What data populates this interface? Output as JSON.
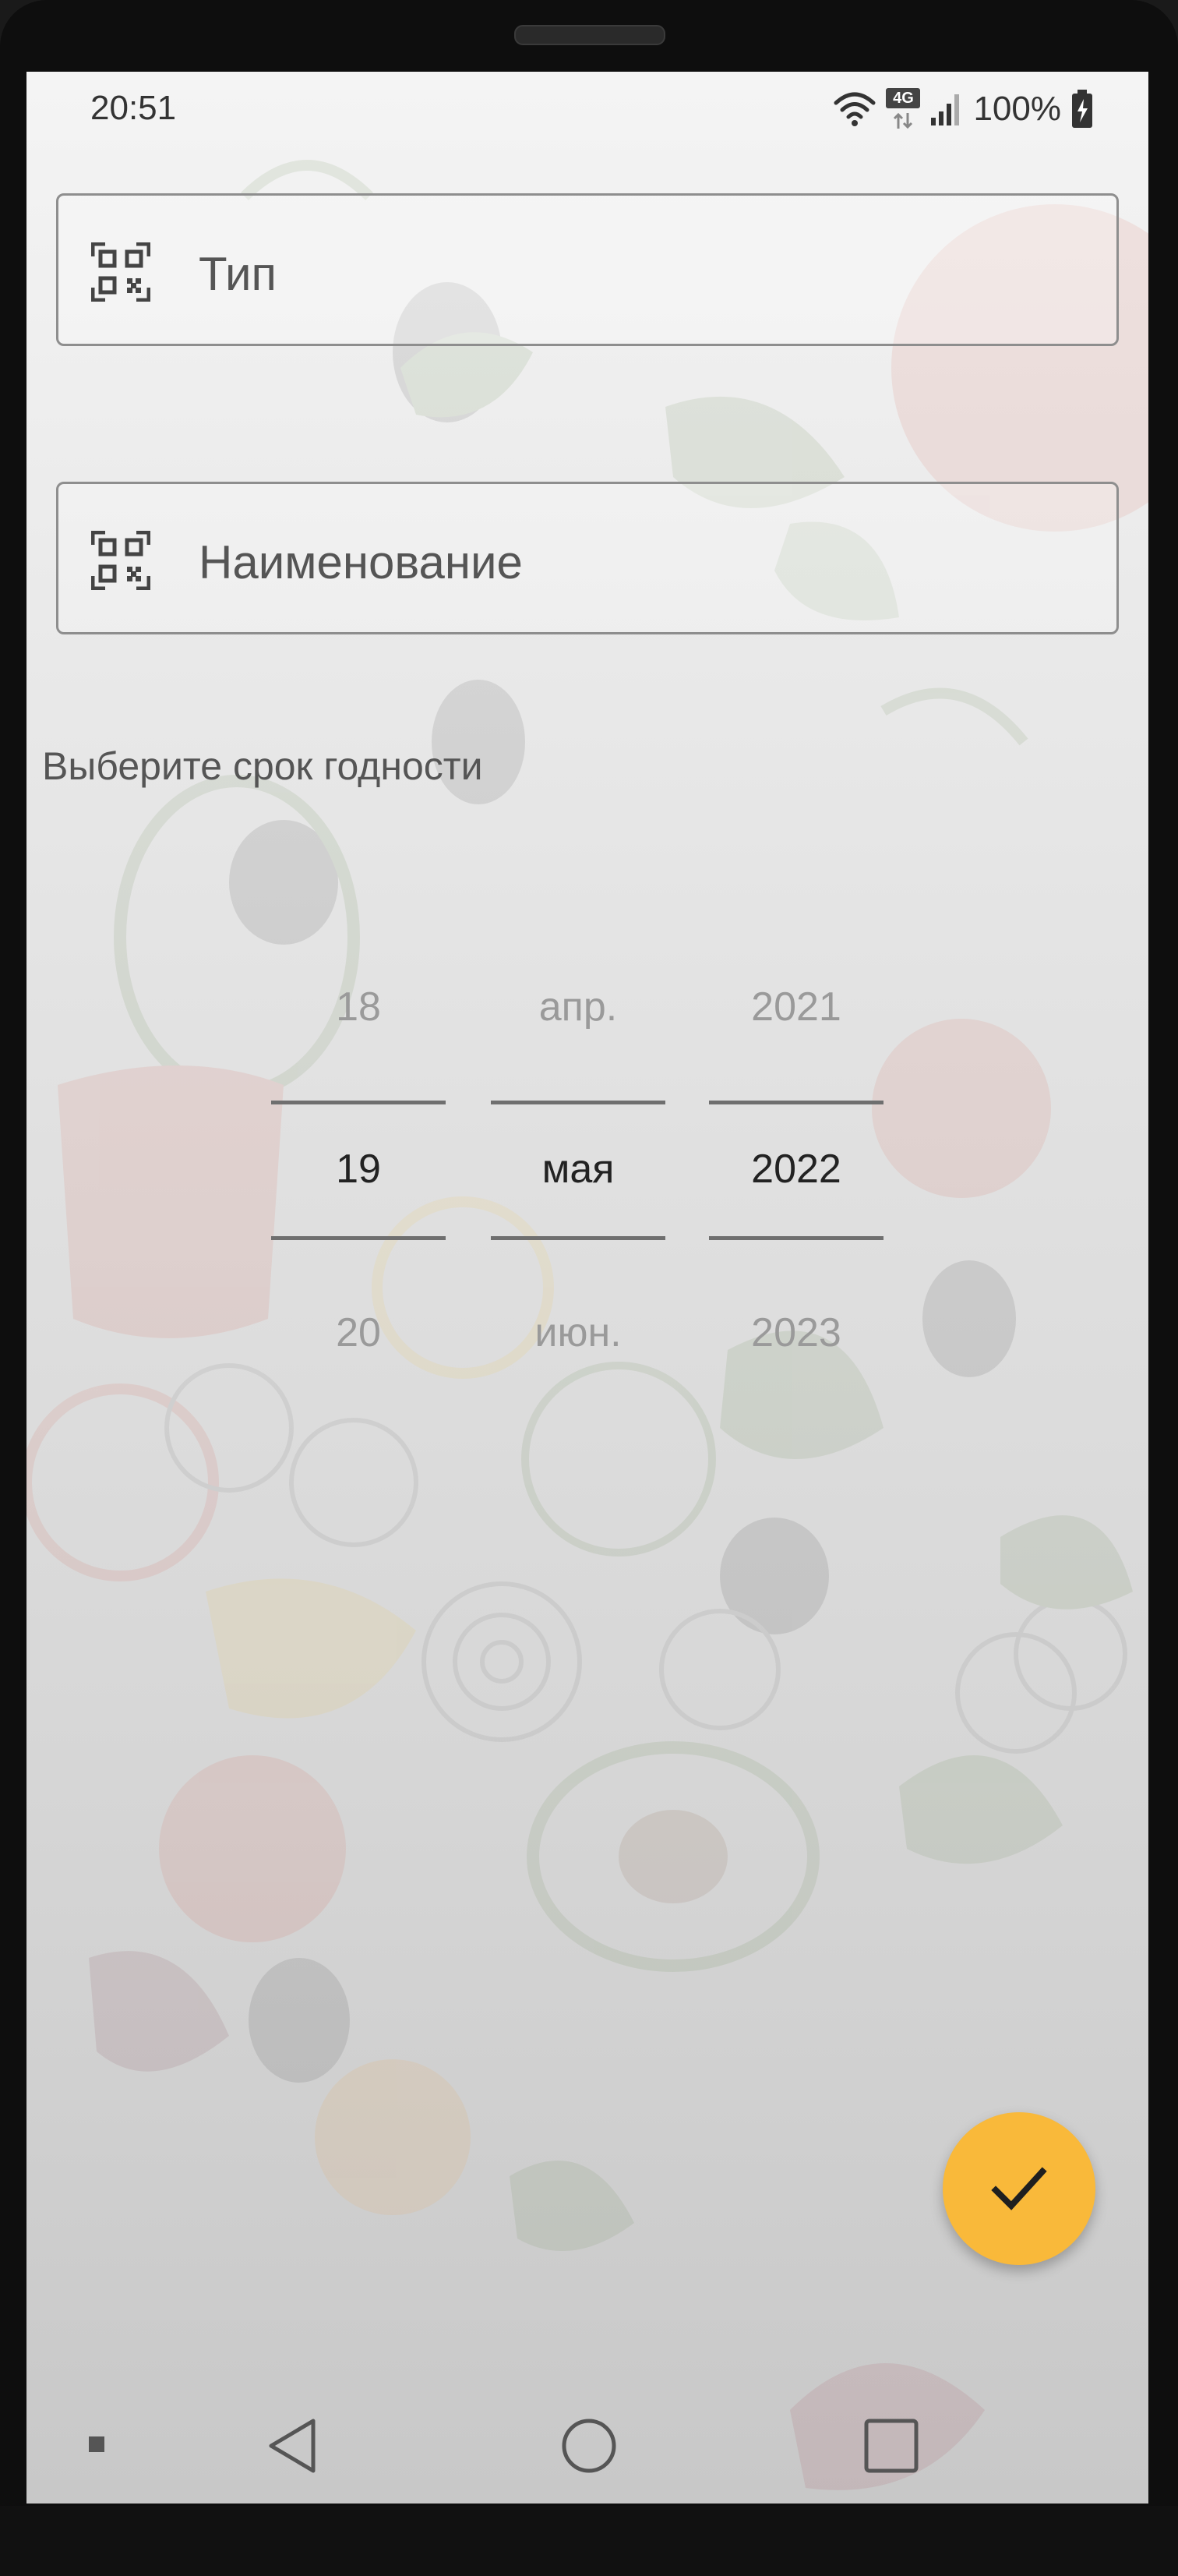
{
  "status_bar": {
    "time": "20:51",
    "network_label": "4G",
    "battery_percent": "100%",
    "icons": [
      "wifi-icon",
      "mobile-data-4g-icon",
      "signal-icon",
      "battery-charging-icon"
    ]
  },
  "form": {
    "type_field": {
      "placeholder": "Тип",
      "value": "",
      "icon": "qr-scan-icon"
    },
    "name_field": {
      "placeholder": "Наименование",
      "value": "",
      "icon": "qr-scan-icon"
    },
    "expiry_label": "Выберите срок годности"
  },
  "date_picker": {
    "day": {
      "prev": "18",
      "current": "19",
      "next": "20"
    },
    "month": {
      "prev": "апр.",
      "current": "мая",
      "next": "июн."
    },
    "year": {
      "prev": "2021",
      "current": "2022",
      "next": "2023"
    }
  },
  "fab": {
    "icon": "check-icon",
    "color": "#F9B93A"
  },
  "navigation_bar": {
    "buttons": [
      "menu-dot-icon",
      "back-icon",
      "home-icon",
      "recents-icon"
    ]
  }
}
